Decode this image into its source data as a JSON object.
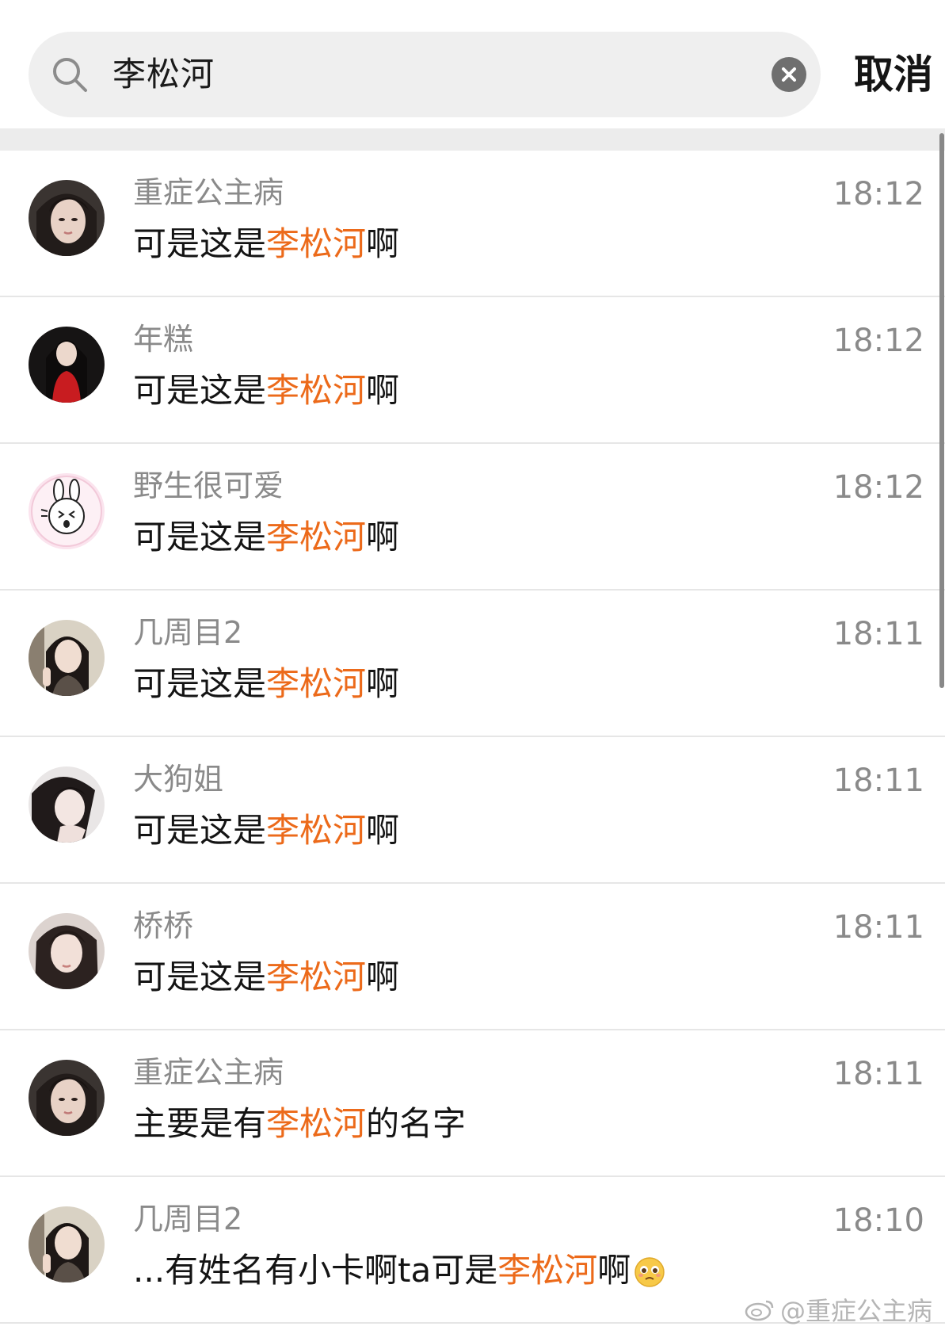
{
  "search": {
    "query": "李松河",
    "cancel_label": "取消"
  },
  "results": [
    {
      "name": "重症公主病",
      "time": "18:12",
      "before": "可是这是",
      "keyword": "李松河",
      "after": "啊",
      "avatar_icon": "avatar-photo-icon"
    },
    {
      "name": "年糕",
      "time": "18:12",
      "before": "可是这是",
      "keyword": "李松河",
      "after": "啊",
      "avatar_icon": "avatar-photo-icon"
    },
    {
      "name": "野生很可爱",
      "time": "18:12",
      "before": "可是这是",
      "keyword": "李松河",
      "after": "啊",
      "avatar_icon": "bunny-avatar-icon"
    },
    {
      "name": "几周目2",
      "time": "18:11",
      "before": "可是这是",
      "keyword": "李松河",
      "after": "啊",
      "avatar_icon": "avatar-photo-icon"
    },
    {
      "name": "大狗姐",
      "time": "18:11",
      "before": "可是这是",
      "keyword": "李松河",
      "after": "啊",
      "avatar_icon": "avatar-photo-icon"
    },
    {
      "name": "桥桥",
      "time": "18:11",
      "before": "可是这是",
      "keyword": "李松河",
      "after": "啊",
      "avatar_icon": "avatar-photo-icon"
    },
    {
      "name": "重症公主病",
      "time": "18:11",
      "before": "主要是有",
      "keyword": "李松河",
      "after": "的名字",
      "avatar_icon": "avatar-photo-icon"
    },
    {
      "name": "几周目2",
      "time": "18:10",
      "before": "...有姓名有小卡啊ta可是",
      "keyword": "李松河",
      "after": "啊",
      "avatar_icon": "avatar-photo-icon",
      "emoji": "pleading-face-icon"
    }
  ],
  "watermark": "@重症公主病",
  "colors": {
    "highlight": "#ec6a1a",
    "secondary_text": "#8a8a8a",
    "search_bg": "#efefef"
  }
}
